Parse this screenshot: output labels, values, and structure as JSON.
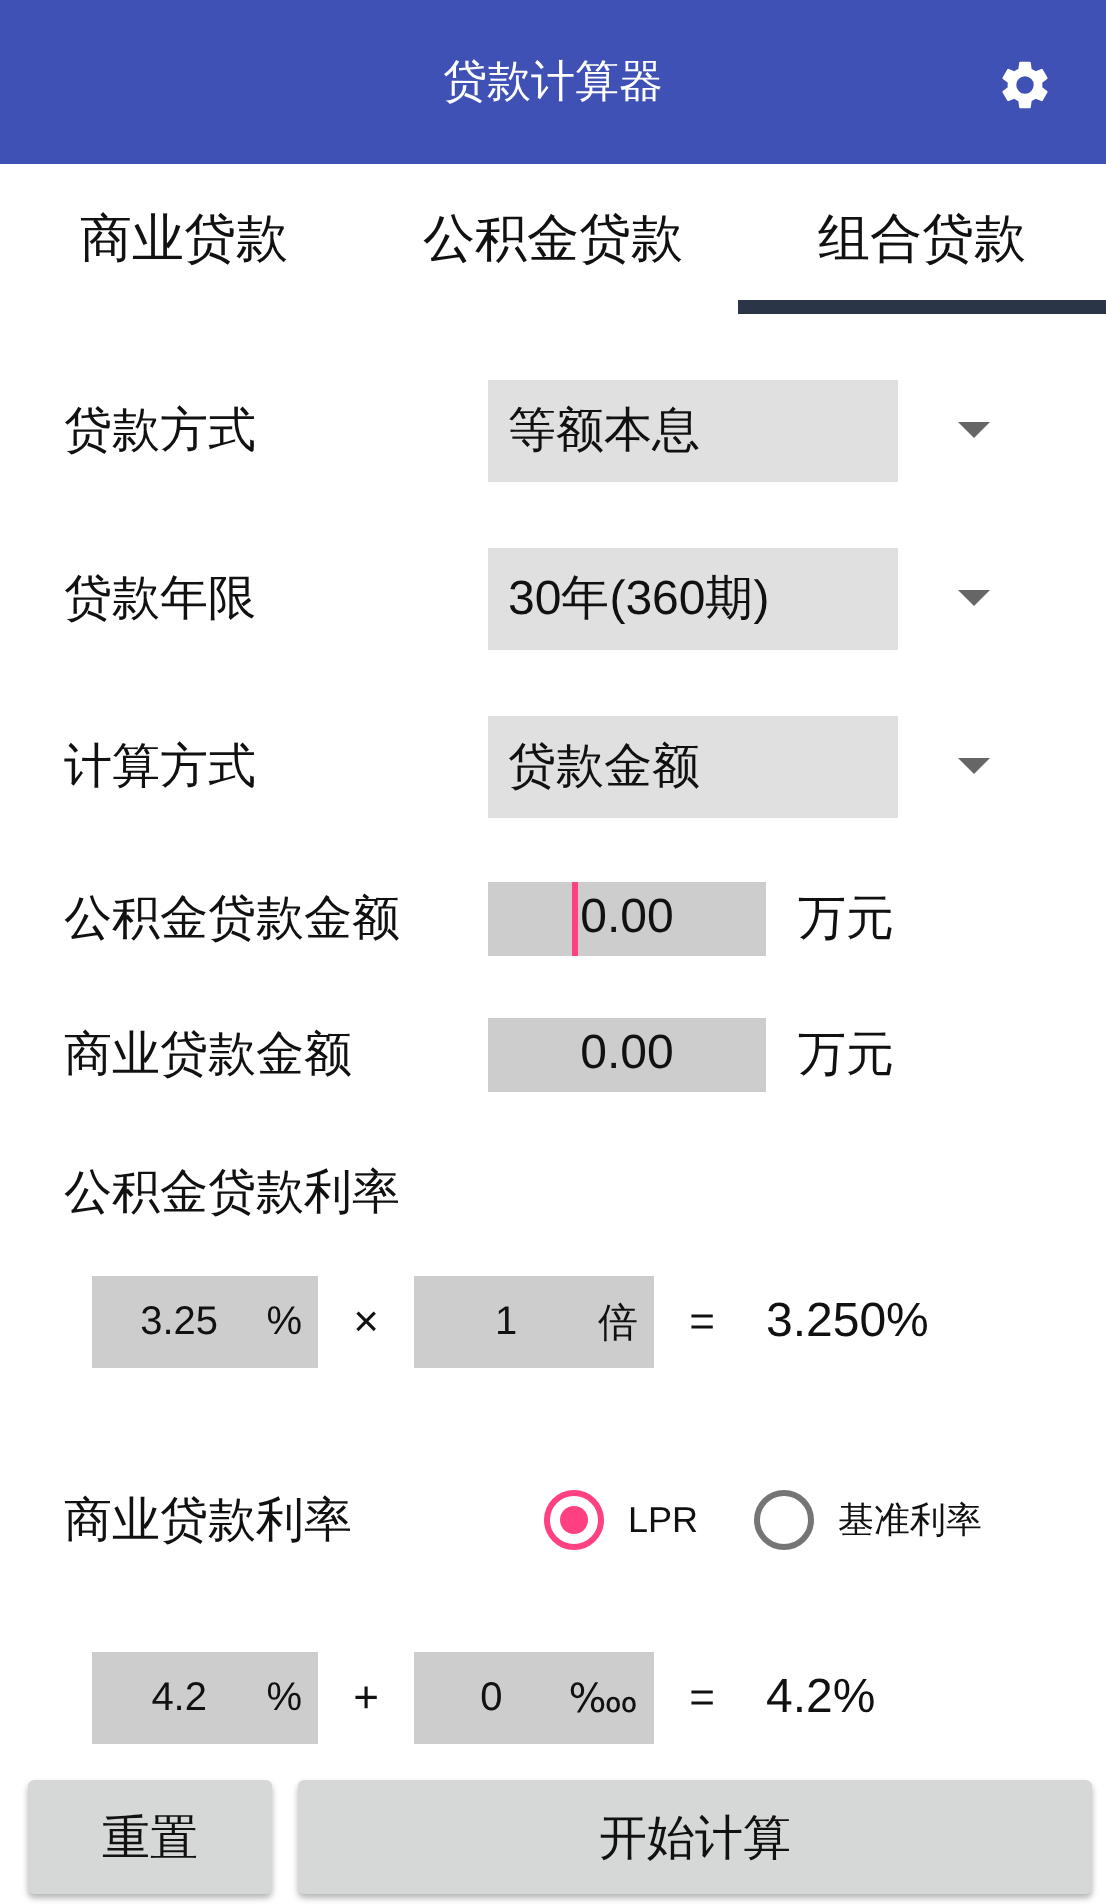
{
  "app_bar": {
    "title": "贷款计算器"
  },
  "tabs": [
    {
      "label": "商业贷款",
      "selected": false
    },
    {
      "label": "公积金贷款",
      "selected": false
    },
    {
      "label": "组合贷款",
      "selected": true
    }
  ],
  "selects": [
    {
      "label": "贷款方式",
      "value": "等额本息"
    },
    {
      "label": "贷款年限",
      "value": "30年(360期)"
    },
    {
      "label": "计算方式",
      "value": "贷款金额"
    }
  ],
  "amounts": [
    {
      "label": "公积金贷款金额",
      "value": "0.00",
      "unit": "万元",
      "focused": true
    },
    {
      "label": "商业贷款金额",
      "value": "0.00",
      "unit": "万元",
      "focused": false
    }
  ],
  "fund_rate": {
    "label": "公积金贷款利率",
    "base": {
      "value": "3.25",
      "unit": "%"
    },
    "operator": "×",
    "factor": {
      "value": "1",
      "unit": "倍"
    },
    "equals": "=",
    "result": "3.250%"
  },
  "commercial_rate": {
    "label": "商业贷款利率",
    "options": [
      {
        "label": "LPR",
        "selected": true
      },
      {
        "label": "基准利率",
        "selected": false
      }
    ],
    "base": {
      "value": "4.2",
      "unit": "%"
    },
    "operator": "+",
    "factor": {
      "value": "0",
      "unit": "‱"
    },
    "equals": "=",
    "result": "4.2%"
  },
  "buttons": [
    "重置",
    "开始计算"
  ]
}
